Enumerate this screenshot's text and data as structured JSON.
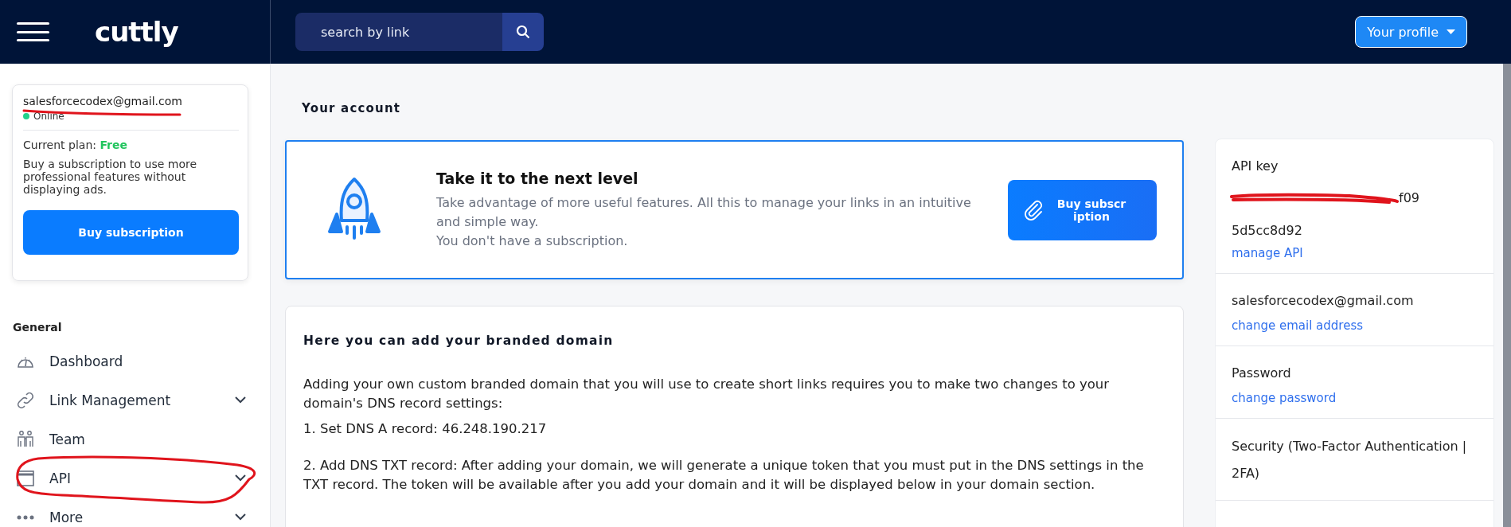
{
  "header": {
    "logo": "cuttly",
    "search": {
      "placeholder": "search by link"
    },
    "profile_button": "Your profile"
  },
  "sidebar": {
    "account": {
      "email": "salesforcecodex@gmail.com",
      "status": "Online",
      "online": true,
      "plan_label": "Current plan:",
      "plan": "Free",
      "description": "Buy a subscription to use more professional features without displaying ads.",
      "button": "Buy subscription"
    },
    "section_title": "General",
    "items": [
      {
        "label": "Dashboard",
        "expandable": false
      },
      {
        "label": "Link Management",
        "expandable": true
      },
      {
        "label": "Team",
        "expandable": false
      },
      {
        "label": "API",
        "expandable": true
      },
      {
        "label": "More",
        "expandable": true
      }
    ]
  },
  "main": {
    "title": "Your account",
    "promo": {
      "title": "Take it to the next level",
      "lines": [
        "Take advantage of more useful features. All this to manage your links in an intuitive and simple way.",
        "You don't have a subscription."
      ],
      "button": "Buy subscription"
    },
    "domain": {
      "title": "Here you can add your branded domain",
      "paragraphs": [
        "Adding your own custom branded domain that you will use to create short links requires you to make two changes to your domain's DNS record settings:",
        "1. Set DNS A record: 46.248.190.217",
        "2. Add DNS TXT record: After adding your domain, we will generate a unique token that you must put in the DNS settings in the TXT record. The token will be available after you add your domain and it will be displayed below in your domain section."
      ]
    }
  },
  "account_panel": {
    "sections": [
      {
        "kind": "api_key",
        "label": "API key",
        "key_end": "f09",
        "key_line_2": "5d5cc8d92",
        "link": "manage API"
      },
      {
        "kind": "field",
        "value": "salesforcecodex@gmail.com",
        "link": "change email address"
      },
      {
        "kind": "field",
        "label": "Password",
        "link": "change password"
      },
      {
        "kind": "field",
        "label": "Security (Two-Factor Authentication | 2FA)"
      }
    ]
  }
}
